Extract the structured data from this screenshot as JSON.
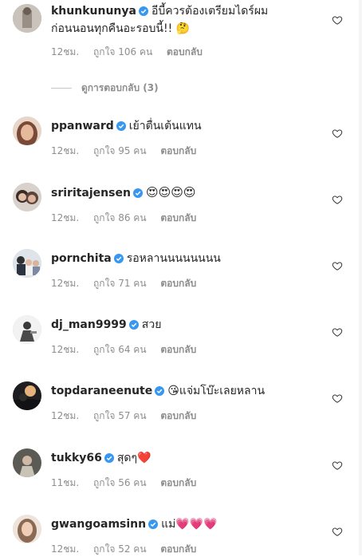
{
  "comments": [
    {
      "username": "khunkununya",
      "text": "อีบี้ควรต้องเตรียมไดร์ผม",
      "text2": "ก่อนนอนทุกคืนอะรอบนี้!! 🤔",
      "time": "12ชม.",
      "likes": "ถูกใจ 106 คน",
      "reply": "ตอบกลับ",
      "avatar_color": "#b9b4ad"
    },
    {
      "username": "ppanward",
      "text": "เย้าตื่นเต้นแทน",
      "time": "12ชม.",
      "likes": "ถูกใจ 95 คน",
      "reply": "ตอบกลับ",
      "avatar_color": "#c98f72"
    },
    {
      "username": "sriritajensen",
      "text": "😍😍😍😍",
      "time": "12ชม.",
      "likes": "ถูกใจ 86 คน",
      "reply": "ตอบกลับ",
      "avatar_color": "#4a3a36"
    },
    {
      "username": "pornchita",
      "text": "รอหลานนนนนนนน",
      "time": "12ชม.",
      "likes": "ถูกใจ 71 คน",
      "reply": "ตอบกลับ",
      "avatar_color": "#3b4252"
    },
    {
      "username": "dj_man9999",
      "text": "สวย",
      "time": "12ชม.",
      "likes": "ถูกใจ 64 คน",
      "reply": "ตอบกลับ",
      "avatar_color": "#6b6b6b"
    },
    {
      "username": "topdaraneenute",
      "text": "😘แจ่มโบ๊ะเลยหลาน",
      "time": "12ชม.",
      "likes": "ถูกใจ 57 คน",
      "reply": "ตอบกลับ",
      "avatar_color": "#2a2a2e"
    },
    {
      "username": "tukky66",
      "text": "สุดๆ❤️",
      "time": "11ชม.",
      "likes": "ถูกใจ 56 คน",
      "reply": "ตอบกลับ",
      "avatar_color": "#8d8a86"
    },
    {
      "username": "gwangoamsinn",
      "text": "แม่💗💗💗",
      "time": "12ชม.",
      "likes": "ถูกใจ 52 คน",
      "reply": "ตอบกลับ",
      "avatar_color": "#d4b7a5"
    }
  ],
  "view_replies": "ดูการตอบกลับ (3)",
  "colors": {
    "verified": "#3897f0",
    "meta": "#8e8e8e",
    "text": "#262626"
  }
}
